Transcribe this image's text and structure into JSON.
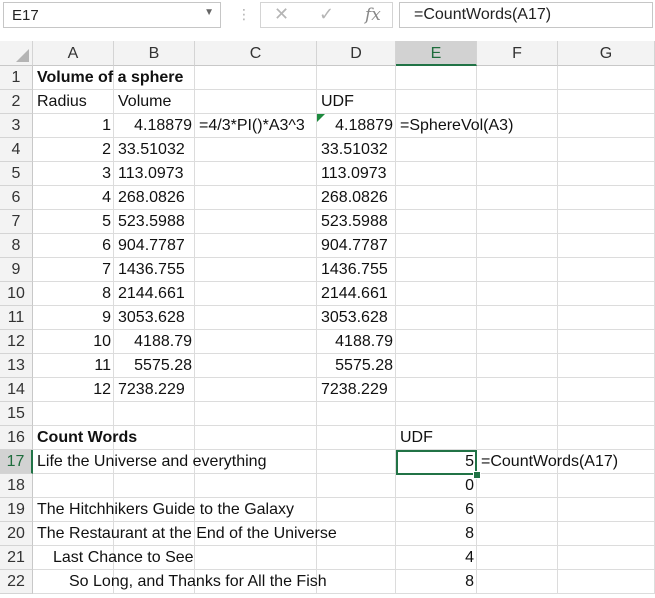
{
  "formula_bar": {
    "name_box": "E17",
    "cancel_icon": "✕",
    "enter_icon": "✓",
    "fx_label": "fx",
    "formula": "=CountWords(A17)"
  },
  "columns": [
    "A",
    "B",
    "C",
    "D",
    "E",
    "F",
    "G"
  ],
  "selected_cell": "E17",
  "rows": [
    {
      "num": "1",
      "cells": [
        {
          "col": "A",
          "text": "Volume of a sphere",
          "bold": true
        }
      ]
    },
    {
      "num": "2",
      "cells": [
        {
          "col": "A",
          "text": "Radius"
        },
        {
          "col": "B",
          "text": "Volume"
        },
        {
          "col": "D",
          "text": "UDF"
        }
      ]
    },
    {
      "num": "3",
      "cells": [
        {
          "col": "A",
          "text": "1",
          "align": "right"
        },
        {
          "col": "B",
          "text": "4.18879",
          "align": "right"
        },
        {
          "col": "C",
          "text": "=4/3*PI()*A3^3"
        },
        {
          "col": "D",
          "text": "4.18879",
          "align": "right"
        },
        {
          "col": "E",
          "text": "=SphereVol(A3)"
        }
      ]
    },
    {
      "num": "4",
      "cells": [
        {
          "col": "A",
          "text": "2",
          "align": "right"
        },
        {
          "col": "B",
          "text": "33.51032"
        },
        {
          "col": "D",
          "text": "33.51032"
        }
      ]
    },
    {
      "num": "5",
      "cells": [
        {
          "col": "A",
          "text": "3",
          "align": "right"
        },
        {
          "col": "B",
          "text": "113.0973"
        },
        {
          "col": "D",
          "text": "113.0973"
        }
      ]
    },
    {
      "num": "6",
      "cells": [
        {
          "col": "A",
          "text": "4",
          "align": "right"
        },
        {
          "col": "B",
          "text": "268.0826"
        },
        {
          "col": "D",
          "text": "268.0826"
        }
      ]
    },
    {
      "num": "7",
      "cells": [
        {
          "col": "A",
          "text": "5",
          "align": "right"
        },
        {
          "col": "B",
          "text": "523.5988"
        },
        {
          "col": "D",
          "text": "523.5988"
        }
      ]
    },
    {
      "num": "8",
      "cells": [
        {
          "col": "A",
          "text": "6",
          "align": "right"
        },
        {
          "col": "B",
          "text": "904.7787"
        },
        {
          "col": "D",
          "text": "904.7787"
        }
      ]
    },
    {
      "num": "9",
      "cells": [
        {
          "col": "A",
          "text": "7",
          "align": "right"
        },
        {
          "col": "B",
          "text": "1436.755"
        },
        {
          "col": "D",
          "text": "1436.755"
        }
      ]
    },
    {
      "num": "10",
      "cells": [
        {
          "col": "A",
          "text": "8",
          "align": "right"
        },
        {
          "col": "B",
          "text": "2144.661"
        },
        {
          "col": "D",
          "text": "2144.661"
        }
      ]
    },
    {
      "num": "11",
      "cells": [
        {
          "col": "A",
          "text": "9",
          "align": "right"
        },
        {
          "col": "B",
          "text": "3053.628"
        },
        {
          "col": "D",
          "text": "3053.628"
        }
      ]
    },
    {
      "num": "12",
      "cells": [
        {
          "col": "A",
          "text": "10",
          "align": "right"
        },
        {
          "col": "B",
          "text": "4188.79",
          "align": "right"
        },
        {
          "col": "D",
          "text": "4188.79",
          "align": "right"
        }
      ]
    },
    {
      "num": "13",
      "cells": [
        {
          "col": "A",
          "text": "11",
          "align": "right"
        },
        {
          "col": "B",
          "text": "5575.28",
          "align": "right"
        },
        {
          "col": "D",
          "text": "5575.28",
          "align": "right"
        }
      ]
    },
    {
      "num": "14",
      "cells": [
        {
          "col": "A",
          "text": "12",
          "align": "right"
        },
        {
          "col": "B",
          "text": "7238.229"
        },
        {
          "col": "D",
          "text": "7238.229"
        }
      ]
    },
    {
      "num": "15",
      "cells": []
    },
    {
      "num": "16",
      "cells": [
        {
          "col": "A",
          "text": "Count Words",
          "bold": true
        },
        {
          "col": "E",
          "text": "UDF"
        }
      ]
    },
    {
      "num": "17",
      "cells": [
        {
          "col": "A",
          "text": "Life the Universe and everything"
        },
        {
          "col": "E",
          "text": "5",
          "align": "right"
        },
        {
          "col": "F",
          "text": "=CountWords(A17)"
        }
      ]
    },
    {
      "num": "18",
      "cells": [
        {
          "col": "E",
          "text": "0",
          "align": "right"
        }
      ]
    },
    {
      "num": "19",
      "cells": [
        {
          "col": "A",
          "text": "The Hitchhikers Guide to the Galaxy"
        },
        {
          "col": "E",
          "text": "6",
          "align": "right"
        }
      ]
    },
    {
      "num": "20",
      "cells": [
        {
          "col": "A",
          "text": "The Restaurant at the End of the Universe"
        },
        {
          "col": "E",
          "text": "8",
          "align": "right"
        }
      ]
    },
    {
      "num": "21",
      "cells": [
        {
          "col": "A",
          "text": "Last Chance to See",
          "indent": 1
        },
        {
          "col": "E",
          "text": "4",
          "align": "right"
        }
      ]
    },
    {
      "num": "22",
      "cells": [
        {
          "col": "A",
          "text": "So Long, and Thanks for All the Fish",
          "indent": 2
        },
        {
          "col": "E",
          "text": "8",
          "align": "right"
        }
      ]
    }
  ]
}
